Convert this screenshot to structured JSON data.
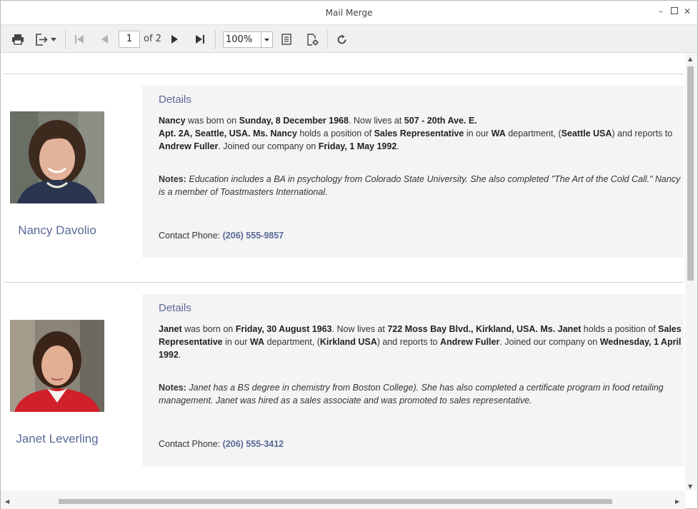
{
  "window": {
    "title": "Mail Merge"
  },
  "toolbar": {
    "current_page": "1",
    "page_total_label": "of 2",
    "zoom": "100%"
  },
  "records": [
    {
      "name": "Nancy Davolio",
      "details_title": "Details",
      "first_name": "Nancy",
      "birth_date": "Sunday, 8 December 1968",
      "address_line1": "507 - 20th Ave. E.",
      "address_line2": "Apt. 2A, Seattle, USA.",
      "title_of_courtesy": "Ms.",
      "position": "Sales Representative",
      "department": "WA",
      "location": "Seattle USA",
      "reports_to": "Andrew Fuller",
      "hire_date": "Friday, 1 May 1992",
      "notes_label": "Notes:",
      "notes": "Education includes a BA in psychology from Colorado State University.  She also completed \"The Art of the Cold Call.\" Nancy is a member of Toastmasters International.",
      "phone_label": "Contact Phone:",
      "phone": "(206) 555-9857"
    },
    {
      "name": "Janet Leverling",
      "details_title": "Details",
      "first_name": "Janet",
      "birth_date": "Friday, 30 August 1963",
      "address_line1": "722 Moss Bay Blvd., Kirkland, USA.",
      "title_of_courtesy": "Ms.",
      "position": "Sales Representative",
      "department": "WA",
      "location": "Kirkland USA",
      "reports_to": "Andrew Fuller",
      "hire_date": "Wednesday, 1 April 1992",
      "notes_label": "Notes:",
      "notes": "Janet has a BS degree in chemistry from Boston College).  She has also completed a certificate program in food retailing management.  Janet was hired as a sales associate and was promoted to sales representative.",
      "phone_label": "Contact Phone:",
      "phone": "(206) 555-3412"
    }
  ],
  "text": {
    "was_born_on": "was born on",
    "now_lives_at": "Now lives at",
    "holds_a_position_of": "holds a position of",
    "in_our": "in our",
    "department_open": "department, (",
    "and_reports_to": ") and reports to",
    "joined_company_on": "Joined our company on"
  },
  "colors": {
    "accent": "#5a6a97",
    "details_bg": "#f4f4f4"
  }
}
